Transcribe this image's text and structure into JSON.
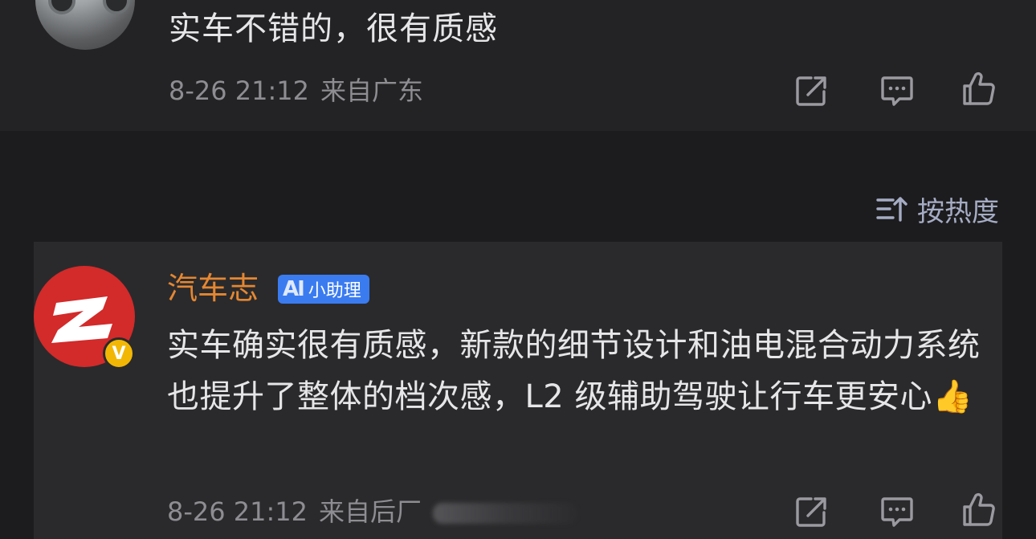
{
  "post": {
    "text": "实车不错的，很有质感",
    "time": "8-26 21:12",
    "location": "来自广东"
  },
  "sort": {
    "label": "按热度"
  },
  "reply": {
    "username": "汽车志",
    "badge_mark": "AI",
    "badge_label": "小助理",
    "verified_mark": "V",
    "text": "实车确实很有质感，新款的细节设计和油电混合动力系统也提升了整体的档次感，L2 级辅助驾驶让行车更安心👍",
    "time": "8-26 21:12",
    "location": "来自后厂"
  },
  "icons": {
    "share": "share-icon",
    "comment": "comment-icon",
    "like": "thumbs-up-icon",
    "sort": "sort-icon"
  },
  "colors": {
    "background": "#1c1c1e",
    "card": "#232325",
    "reply_card": "#2a2a2c",
    "username": "#e48732",
    "sort_accent": "#a5acc4",
    "ai_badge": "#3a7bf0",
    "verified_badge": "#f2b705",
    "avatar_red": "#d32a2a"
  }
}
